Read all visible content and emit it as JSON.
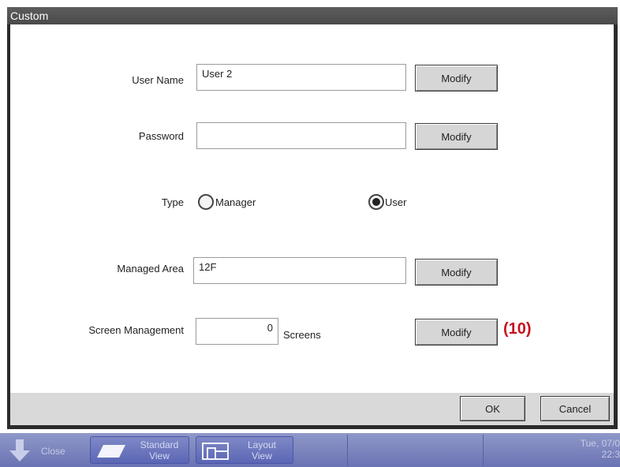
{
  "dialog": {
    "title": "Custom",
    "user_name": {
      "label": "User Name",
      "value": "User 2",
      "modify_label": "Modify"
    },
    "password": {
      "label": "Password",
      "value": "",
      "modify_label": "Modify"
    },
    "type": {
      "label": "Type",
      "options": [
        "Manager",
        "User"
      ],
      "selected": "User"
    },
    "managed_area": {
      "label": "Managed Area",
      "value": "12F",
      "modify_label": "Modify"
    },
    "screen_management": {
      "label": "Screen Management",
      "value": "0",
      "unit": "Screens",
      "modify_label": "Modify"
    },
    "annotation": "(10)",
    "ok_label": "OK",
    "cancel_label": "Cancel"
  },
  "taskbar": {
    "close_label": "Close",
    "standard_view_label": [
      "Standard",
      "View"
    ],
    "layout_view_label": [
      "Layout",
      "View"
    ],
    "datetime": [
      "Tue, 07/0",
      "22:3"
    ]
  },
  "colors": {
    "annotation": "#c8101e",
    "taskbar": "#6a73b3",
    "footer": "#d9d9d9"
  }
}
